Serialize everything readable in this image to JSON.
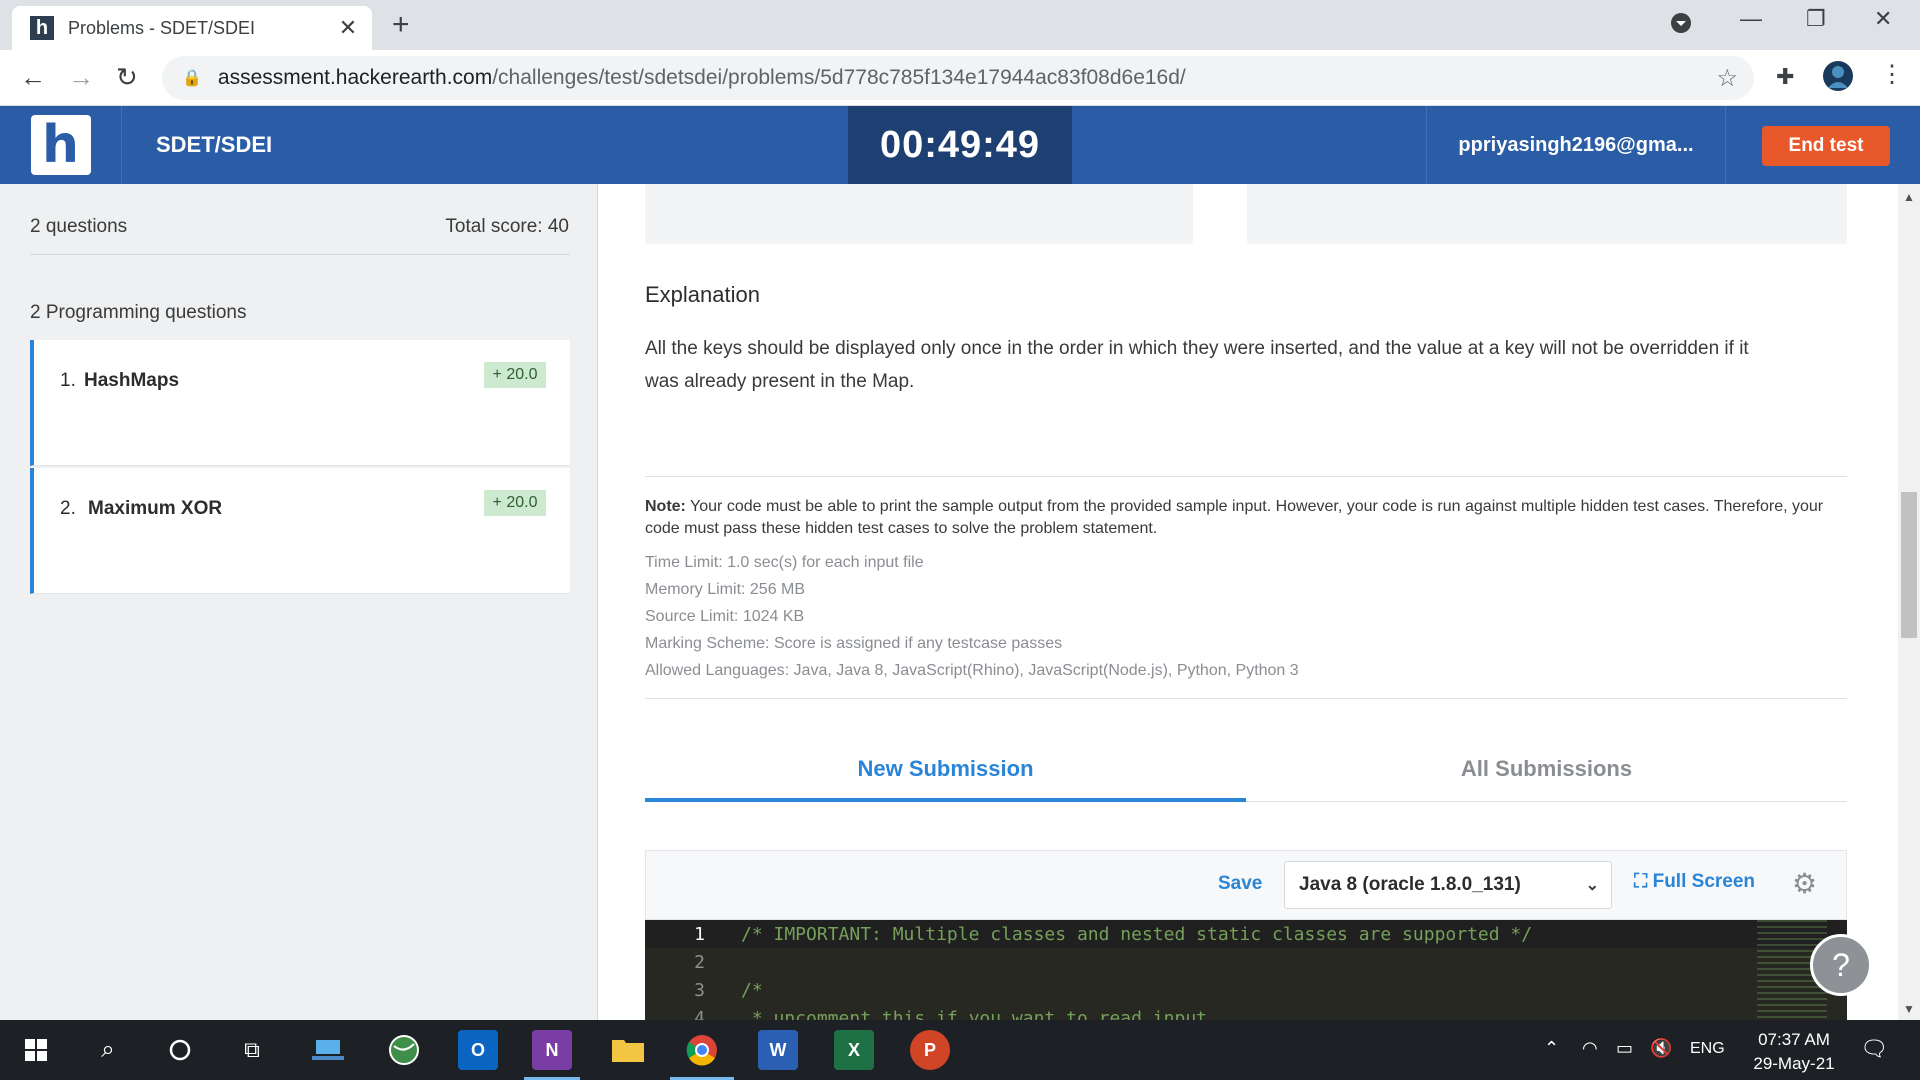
{
  "browser": {
    "tab_title": "Problems - SDET/SDEI",
    "url_domain": "assessment.hackerearth.com",
    "url_path": "/challenges/test/sdetsdei/problems/5d778c785f134e17944ac83f08d6e16d/"
  },
  "header": {
    "logo_letter": "h",
    "test_name": "SDET/SDEI",
    "timer": "00:49:49",
    "user": "ppriyasingh2196@gma...",
    "end_test_label": "End test"
  },
  "sidebar": {
    "question_count": "2 questions",
    "total_score": "Total score: 40",
    "section_heading": "2 Programming questions",
    "questions": [
      {
        "num": "1.",
        "name": "HashMaps",
        "score": "+ 20.0"
      },
      {
        "num": "2.",
        "name": "Maximum XOR",
        "score": "+ 20.0"
      }
    ]
  },
  "problem": {
    "explanation_title": "Explanation",
    "explanation_text": "All the keys should be displayed only once in the order in which they were inserted, and the value at a key will not be overridden if it was already present in the Map.",
    "note_label": "Note:",
    "note_text": " Your code must be able to print the sample output from the provided sample input. However, your code is run against multiple hidden test cases. Therefore, your code must pass these hidden test cases to solve the problem statement.",
    "limits": [
      "Time Limit: 1.0 sec(s) for each input file",
      "Memory Limit: 256 MB",
      "Source Limit: 1024 KB",
      "Marking Scheme: Score is assigned if any testcase passes",
      "Allowed Languages: Java, Java 8, JavaScript(Rhino), JavaScript(Node.js), Python, Python 3"
    ]
  },
  "submission": {
    "tab_new": "New Submission",
    "tab_all": "All Submissions",
    "save_label": "Save",
    "language": "Java 8 (oracle 1.8.0_131)",
    "fullscreen_label": "Full Screen"
  },
  "editor": {
    "lines": [
      {
        "n": "1",
        "code": "/* IMPORTANT: Multiple classes and nested static classes are supported */"
      },
      {
        "n": "2",
        "code": ""
      },
      {
        "n": "3",
        "code": "/*"
      },
      {
        "n": "4",
        "code": " * uncomment this if you want to read input."
      }
    ]
  },
  "help_label": "?",
  "taskbar": {
    "language": "ENG",
    "time": "07:37 AM",
    "date": "29-May-21"
  }
}
